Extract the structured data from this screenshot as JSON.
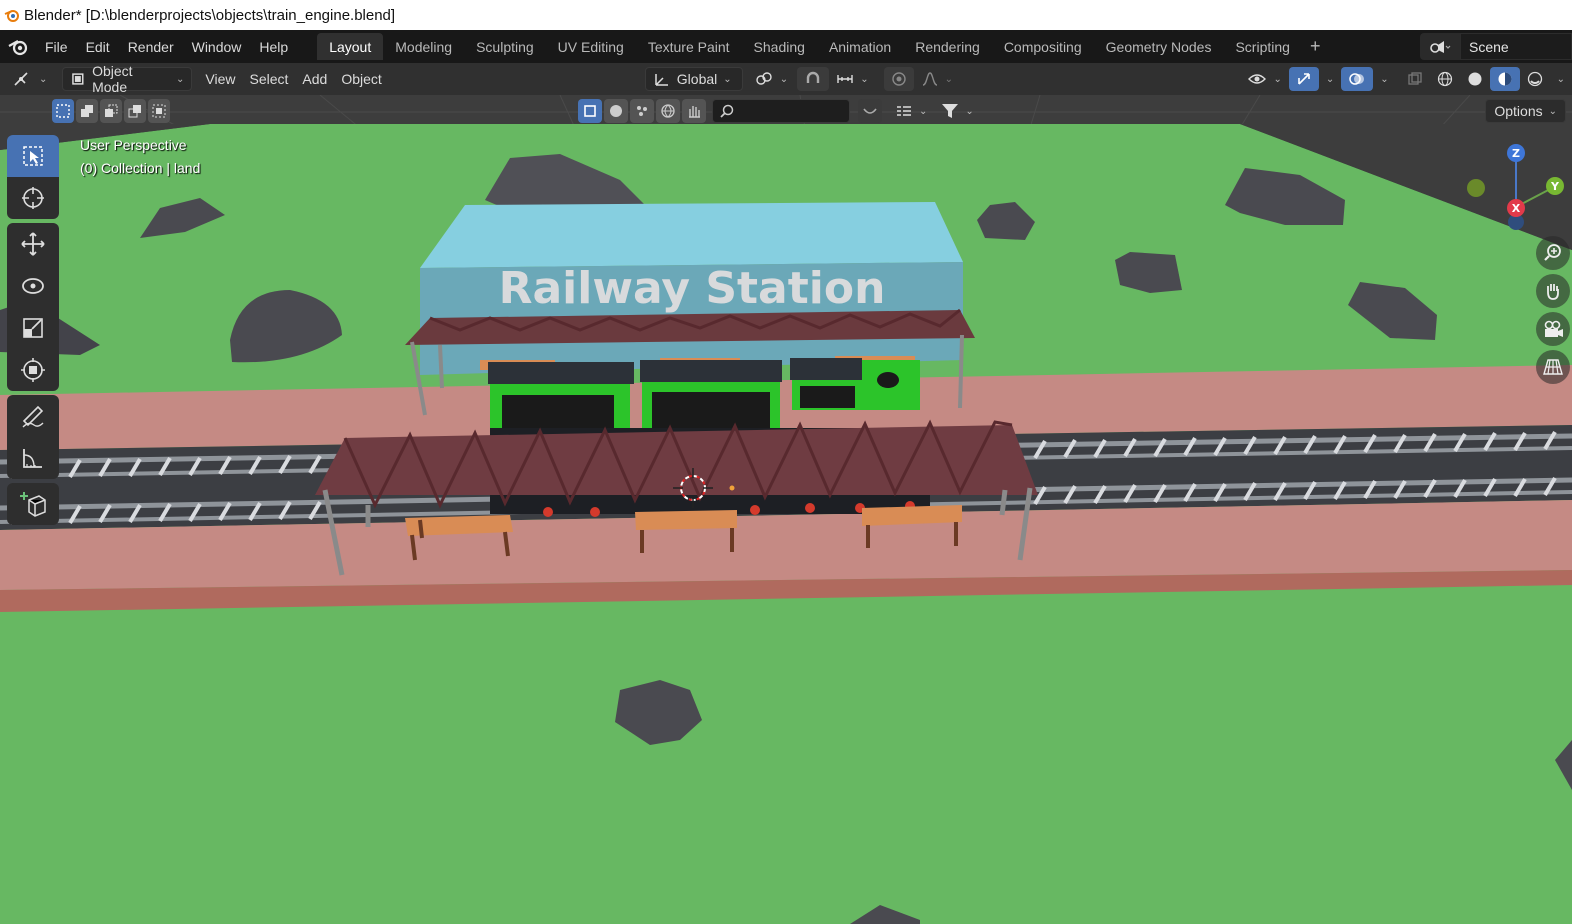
{
  "window": {
    "title": "Blender* [D:\\blenderprojects\\objects\\train_engine.blend]"
  },
  "menu": {
    "items": [
      "File",
      "Edit",
      "Render",
      "Window",
      "Help"
    ]
  },
  "workspaces": {
    "tabs": [
      "Layout",
      "Modeling",
      "Sculpting",
      "UV Editing",
      "Texture Paint",
      "Shading",
      "Animation",
      "Rendering",
      "Compositing",
      "Geometry Nodes",
      "Scripting"
    ],
    "active": "Layout"
  },
  "scene": {
    "name": "Scene"
  },
  "header": {
    "mode": "Object Mode",
    "view": "View",
    "select": "Select",
    "add": "Add",
    "object": "Object",
    "orientation": "Global"
  },
  "tool_header": {
    "options": "Options"
  },
  "viewport": {
    "perspective": "User Perspective",
    "collection": "(0) Collection | land",
    "station_sign": "Railway Station"
  },
  "gizmo": {
    "z": "Z",
    "y": "Y",
    "x": "X"
  },
  "colors": {
    "accent": "#4772b3",
    "grass": "#67b862",
    "platform": "#c58a84",
    "roof": "#6a3a3e",
    "station_wall": "#7fc4d4",
    "train_body": "#2cc42a",
    "rock": "#4a4a50"
  }
}
